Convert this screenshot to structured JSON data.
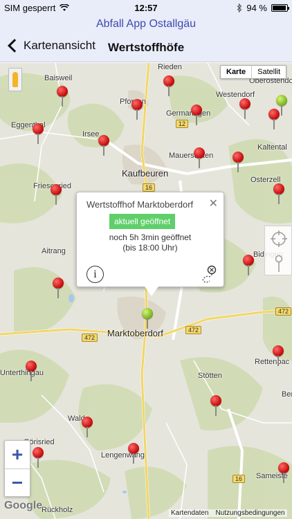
{
  "status_bar": {
    "carrier": "SIM gesperrt",
    "time": "12:57",
    "battery": "94 %",
    "battery_level": 0.94
  },
  "app_title": "Abfall App Ostallgäu",
  "nav": {
    "back_label": "Kartenansicht",
    "title": "Wertstoffhöfe"
  },
  "map": {
    "type_options": [
      "Karte",
      "Satellit"
    ],
    "towns": {
      "rieden": "Rieden",
      "baisweil": "Baisweil",
      "westendorf": "Westendorf",
      "oberostendorf": "Oberostendorf",
      "pforzen": "Pforzen",
      "germaringen": "Germaringen",
      "eggenthal": "Eggenthal",
      "irsee": "Irsee",
      "kaltental": "Kaltental",
      "mauerstetten": "Mauerstetten",
      "kaufbeuren": "Kaufbeuren",
      "osterzell": "Osterzell",
      "friesenried": "Friesenried",
      "bidingen": "Bidingen",
      "aitrang": "Aitrang",
      "marktoberdorf": "Marktoberdorf",
      "unterthingau": "Unterthingau",
      "rettenbach": "Rettenbac",
      "ber": "Ber",
      "stoetten": "Stötten",
      "wald": "Wald",
      "oberried": "Görisried",
      "lengenwang": "Lengenwang",
      "sameister": "Sameiste",
      "rueckholz": "Rückholz"
    },
    "roads": {
      "r12": "12",
      "r16a": "16",
      "r472a": "472",
      "r472b": "472",
      "r472c": "472",
      "r16b": "16"
    },
    "google": "Google",
    "attribution": [
      "Kartendaten",
      "Nutzungsbedingungen"
    ],
    "zoom_in": "+",
    "zoom_out": "−"
  },
  "popup": {
    "title": "Wertstoffhof Marktoberdorf",
    "status": "aktuell geöffnet",
    "line1": "noch 5h 3min geöffnet",
    "line2": "(bis 18:00 Uhr)",
    "info_label": "i",
    "close": "✕"
  },
  "colors": {
    "accent": "#3a4bb0",
    "open_green": "#5fcf6a",
    "pin_red": "#c60d0d",
    "pin_green": "#7fb51f"
  }
}
